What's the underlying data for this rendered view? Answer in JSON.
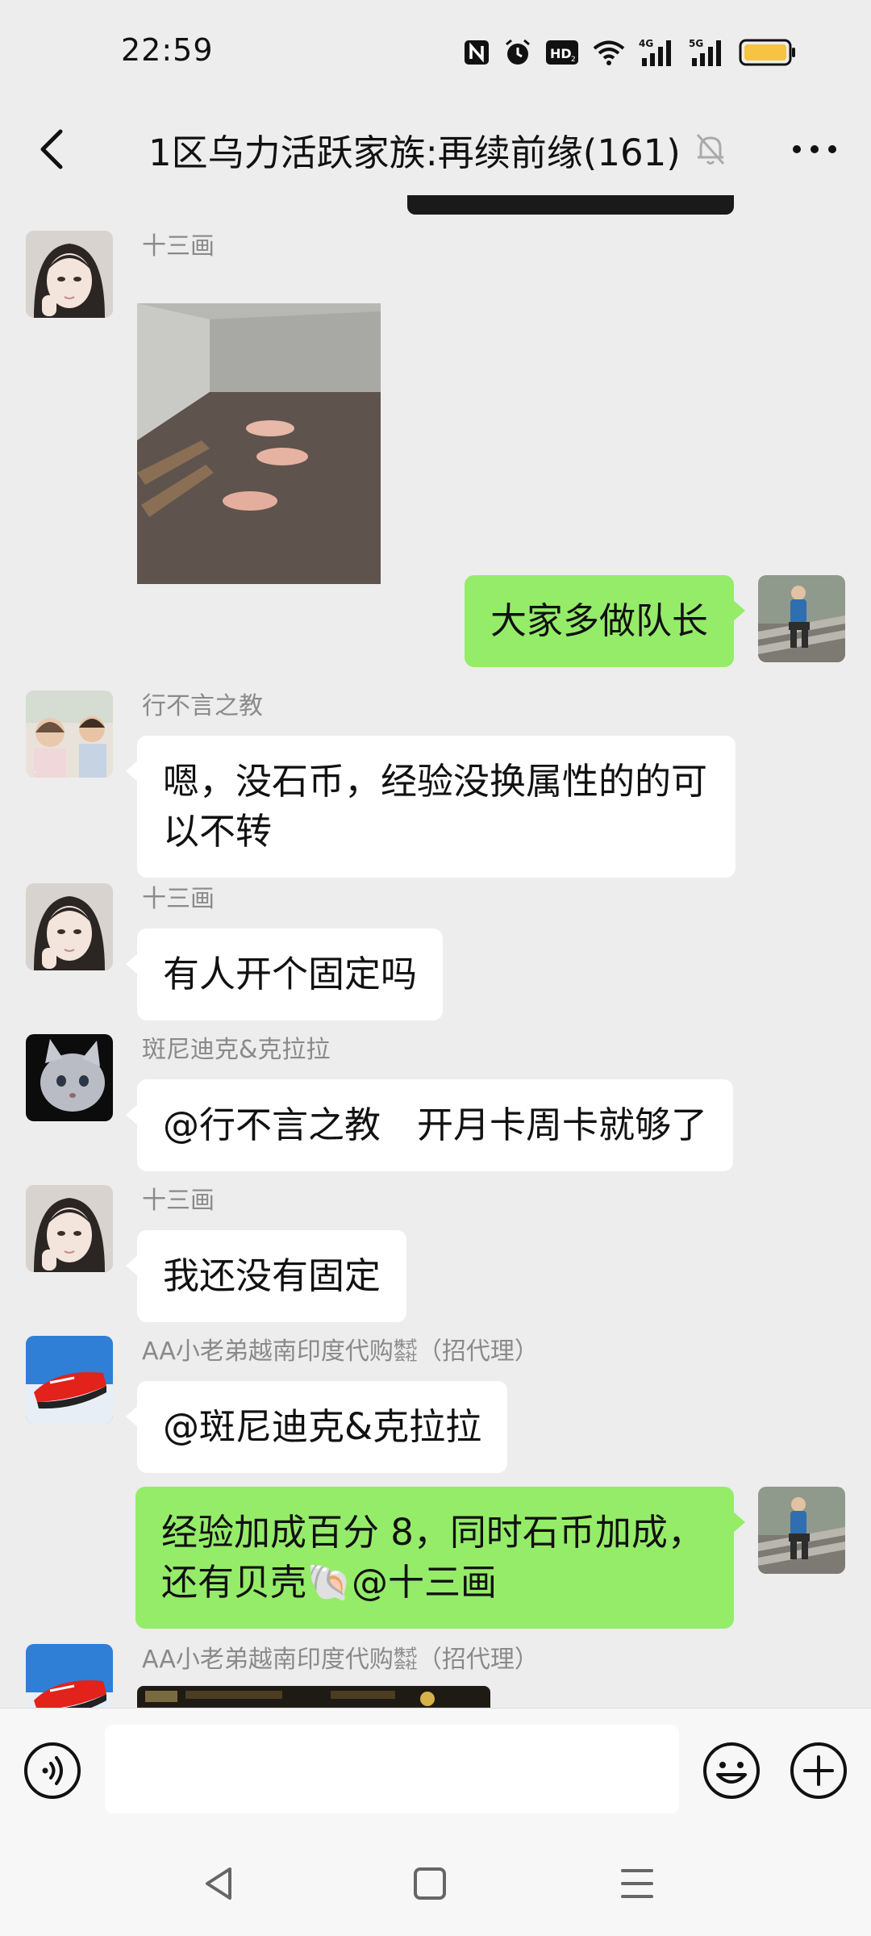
{
  "status_bar": {
    "time": "22:59",
    "icons": [
      "nfc-icon",
      "alarm-icon",
      "hd-icon",
      "wifi-icon",
      "4g-signal-icon",
      "5g-signal-icon",
      "battery-icon"
    ],
    "battery_color": "#f6c343"
  },
  "header": {
    "title": "1区乌力活跃家族:再续前缘(161)"
  },
  "messages": [
    {
      "side": "left",
      "sender": "十三画",
      "type": "image"
    },
    {
      "side": "right",
      "text": "大家多做队长"
    },
    {
      "side": "left",
      "sender": "行不言之教",
      "text_lines": [
        "嗯，没石币，经验没换属性的的可",
        "以不转"
      ]
    },
    {
      "side": "left",
      "sender": "十三画",
      "text": "有人开个固定吗"
    },
    {
      "side": "left",
      "sender": "斑尼迪克&克拉拉",
      "text": "@行不言之教　开月卡周卡就够了"
    },
    {
      "side": "left",
      "sender": "十三画",
      "text": "我还没有固定"
    },
    {
      "side": "left",
      "sender": "AA小老弟越南印度代购㍿（招代理）",
      "text": "@斑尼迪克&克拉拉"
    },
    {
      "side": "right",
      "text_lines": [
        "经验加成百分 8，同时石币加成，",
        "还有贝壳🐚@十三画"
      ]
    },
    {
      "side": "left",
      "sender": "AA小老弟越南印度代购㍿（招代理）",
      "type": "image"
    }
  ],
  "colors": {
    "background": "#ededed",
    "self_bubble": "#95ec69",
    "other_bubble": "#ffffff",
    "sender_name": "#8a8a8a"
  }
}
